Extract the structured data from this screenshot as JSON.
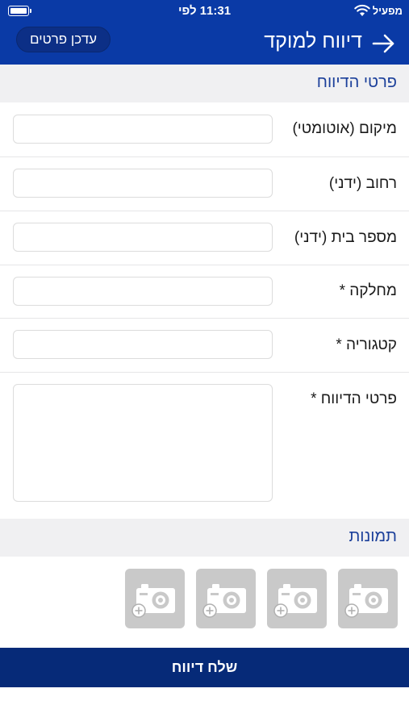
{
  "status_bar": {
    "carrier": "מפעיל",
    "time": "11:31 לפי"
  },
  "nav": {
    "title": "דיווח למוקד",
    "update_button": "עדכן פרטים"
  },
  "sections": {
    "report_details": "פרטי הדיווח",
    "photos": "תמונות"
  },
  "form": {
    "location_label": "מיקום (אוטומטי)",
    "location_value": "",
    "street_label": "רחוב (ידני)",
    "street_value": "",
    "house_number_label": "מספר בית (ידני)",
    "house_number_value": "",
    "department_label": "מחלקה *",
    "department_value": "",
    "category_label": "קטגוריה *",
    "category_value": "",
    "details_label": "פרטי הדיווח *",
    "details_value": ""
  },
  "photos": {
    "slots": [
      "add-photo",
      "add-photo",
      "add-photo",
      "add-photo"
    ]
  },
  "submit_button": "שלח דיווח",
  "colors": {
    "header_blue": "#0a3aa6",
    "submit_blue": "#062a78",
    "section_text": "#1b3f9a",
    "section_bg": "#f0f0f2",
    "photo_slot": "#c9c9c9"
  }
}
